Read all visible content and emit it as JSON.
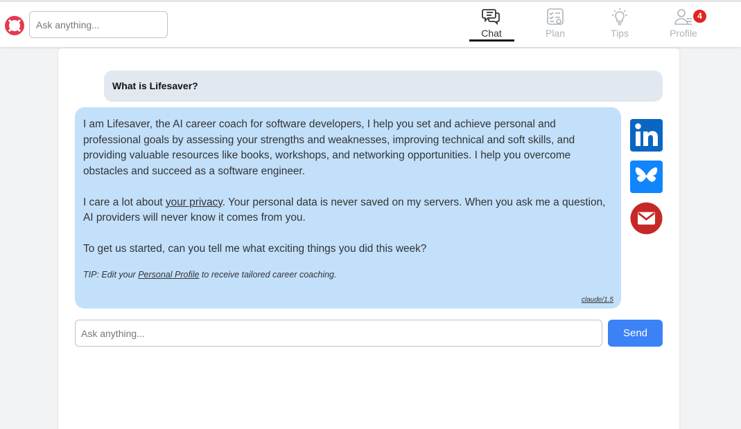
{
  "header": {
    "search_placeholder": "Ask anything...",
    "tabs": [
      {
        "label": "Chat",
        "icon": "chat-icon",
        "active": true
      },
      {
        "label": "Plan",
        "icon": "plan-checklist-icon",
        "active": false
      },
      {
        "label": "Tips",
        "icon": "lightbulb-icon",
        "active": false
      },
      {
        "label": "Profile",
        "icon": "profile-icon",
        "active": false,
        "badge": "4"
      }
    ]
  },
  "chat": {
    "user_message": "What is Lifesaver?",
    "ai_p1": "I am Lifesaver, the AI career coach for software developers, I help you set and achieve personal and professional goals by assessing your strengths and weaknesses, improving technical and soft skills, and providing valuable resources like books, workshops, and networking opportunities. I help you overcome obstacles and succeed as a software engineer.",
    "ai_p2_before": "I care a lot about ",
    "ai_p2_link": "your privacy",
    "ai_p2_after": ". Your personal data is never saved on my servers. When you ask me a question, AI providers will never know it comes from you.",
    "ai_p3": "To get us started, can you tell me what exciting things you did this week?",
    "tip_before": "TIP: Edit your ",
    "tip_link": "Personal Profile",
    "tip_after": " to receive tailored career coaching.",
    "model": "claude/1.5"
  },
  "share": {
    "icons": [
      "linkedin-icon",
      "bluesky-icon",
      "email-icon"
    ],
    "colors": {
      "linkedin": "#0a66c2",
      "bluesky": "#1185fe",
      "email": "#c62828"
    }
  },
  "composer": {
    "placeholder": "Ask anything...",
    "send_label": "Send"
  },
  "colors": {
    "ai_bubble": "#c3e0fb",
    "user_bubble": "#e2e8f0",
    "send_button": "#3b82f6",
    "badge": "#e02424"
  }
}
